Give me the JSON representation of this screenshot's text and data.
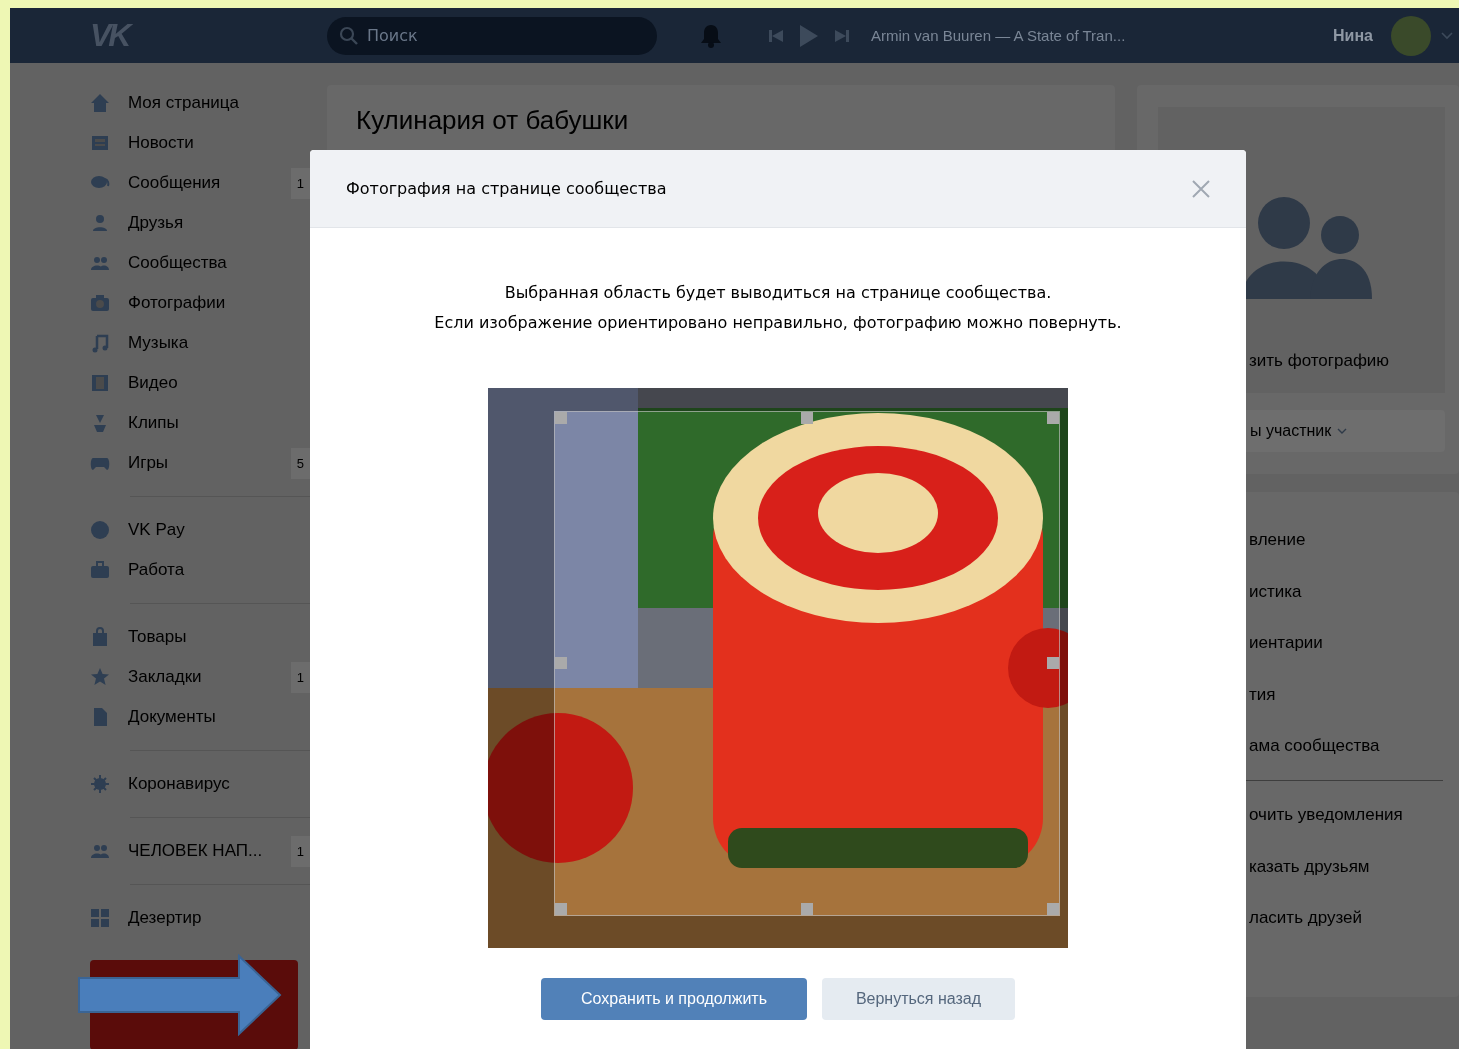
{
  "header": {
    "logo": "VK",
    "search": {
      "placeholder": "Поиск"
    },
    "track": "Armin van Buuren — A State of Tran...",
    "user_name": "Нина"
  },
  "sidebar": {
    "groups": [
      {
        "items": [
          {
            "label": "Моя страница"
          },
          {
            "label": "Новости"
          },
          {
            "label": "Сообщения",
            "count": "1"
          },
          {
            "label": "Друзья"
          },
          {
            "label": "Сообщества"
          },
          {
            "label": "Фотографии"
          },
          {
            "label": "Музыка"
          },
          {
            "label": "Видео"
          },
          {
            "label": "Клипы"
          },
          {
            "label": "Игры",
            "count": "5"
          }
        ]
      },
      {
        "items": [
          {
            "label": "VK Pay"
          },
          {
            "label": "Работа"
          }
        ]
      },
      {
        "items": [
          {
            "label": "Товары"
          },
          {
            "label": "Закладки",
            "count": "1"
          },
          {
            "label": "Документы"
          }
        ]
      },
      {
        "items": [
          {
            "label": "Коронавирус"
          }
        ]
      },
      {
        "items": [
          {
            "label": "ЧЕЛОВЕК НАП...",
            "count": "1"
          }
        ]
      },
      {
        "items": [
          {
            "label": "Дезертир"
          }
        ]
      }
    ]
  },
  "main": {
    "group_title": "Кулинария от бабушки"
  },
  "right_panel": {
    "upload_link": "зить фотографию",
    "member_button": "ы участник",
    "menu_groups": [
      {
        "items": [
          {
            "label": "вление"
          },
          {
            "label": "истика"
          },
          {
            "label": "иентарии"
          },
          {
            "label": "тия"
          },
          {
            "label": "ама сообщества"
          }
        ]
      },
      {
        "items": [
          {
            "label": "очить уведомления"
          },
          {
            "label": "казать друзьям"
          },
          {
            "label": "ласить друзей"
          }
        ]
      }
    ]
  },
  "modal": {
    "title": "Фотография на странице сообщества",
    "description": [
      "Выбранная область будет выводиться на странице сообщества.",
      "Если изображение ориентировано неправильно, фотографию можно повернуть."
    ],
    "buttons": [
      {
        "label": "Сохранить и продолжить",
        "kind": "primary"
      },
      {
        "label": "Вернуться назад",
        "kind": "secondary"
      }
    ]
  }
}
